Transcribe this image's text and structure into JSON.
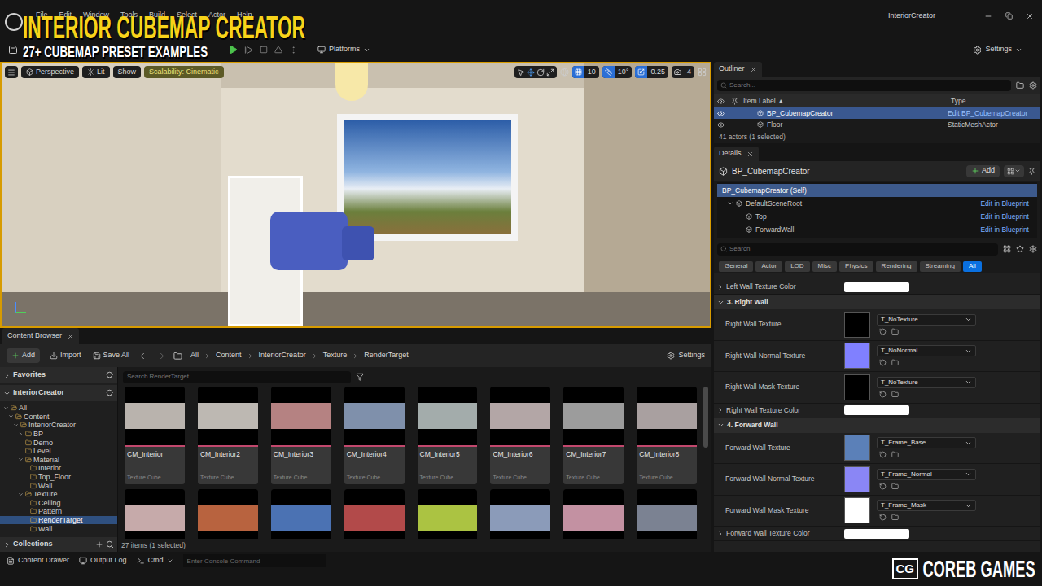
{
  "overlay": {
    "title": "INTERIOR CUBEMAP CREATOR",
    "subtitle": "27+ CUBEMAP PRESET EXAMPLES"
  },
  "menu": [
    "File",
    "Edit",
    "Window",
    "Tools",
    "Build",
    "Select",
    "Actor",
    "Help"
  ],
  "window": {
    "title": "InteriorCreator"
  },
  "toolbar": {
    "platforms": "Platforms",
    "settings": "Settings"
  },
  "viewport": {
    "buttons": [
      {
        "label": "Perspective",
        "highlighted": false
      },
      {
        "label": "Lit",
        "highlighted": false
      },
      {
        "label": "Show",
        "highlighted": false
      },
      {
        "label": "Scalability: Cinematic",
        "highlighted": true
      }
    ],
    "snaps": [
      {
        "value": "10",
        "on": true
      },
      {
        "value": "10°",
        "on": true
      },
      {
        "value": "0.25",
        "on": true
      },
      {
        "value": "4",
        "on": false
      }
    ]
  },
  "content_browser": {
    "tab": "Content Browser",
    "actions": [
      "Add",
      "Import",
      "Save All"
    ],
    "breadcrumb": [
      "All",
      "Content",
      "InteriorCreator",
      "Texture",
      "RenderTarget"
    ],
    "settings": "Settings",
    "search_placeholder": "Search RenderTarget",
    "sections": [
      {
        "label": "Favorites",
        "expanded": false
      },
      {
        "label": "InteriorCreator",
        "expanded": true
      }
    ],
    "tree": [
      {
        "label": "All",
        "depth": 0,
        "has_children": true,
        "expanded": true,
        "selected": false
      },
      {
        "label": "Content",
        "depth": 1,
        "has_children": true,
        "expanded": true,
        "selected": false
      },
      {
        "label": "InteriorCreator",
        "depth": 2,
        "has_children": true,
        "expanded": true,
        "selected": false
      },
      {
        "label": "BP",
        "depth": 3,
        "has_children": true,
        "expanded": false,
        "selected": false
      },
      {
        "label": "Demo",
        "depth": 3,
        "has_children": false,
        "expanded": false,
        "selected": false
      },
      {
        "label": "Level",
        "depth": 3,
        "has_children": false,
        "expanded": false,
        "selected": false
      },
      {
        "label": "Material",
        "depth": 3,
        "has_children": true,
        "expanded": true,
        "selected": false
      },
      {
        "label": "Interior",
        "depth": 4,
        "has_children": false,
        "expanded": false,
        "selected": false
      },
      {
        "label": "Top_Floor",
        "depth": 4,
        "has_children": false,
        "expanded": false,
        "selected": false
      },
      {
        "label": "Wall",
        "depth": 4,
        "has_children": false,
        "expanded": false,
        "selected": false
      },
      {
        "label": "Texture",
        "depth": 3,
        "has_children": true,
        "expanded": true,
        "selected": false
      },
      {
        "label": "Ceiling",
        "depth": 4,
        "has_children": false,
        "expanded": false,
        "selected": false
      },
      {
        "label": "Pattern",
        "depth": 4,
        "has_children": false,
        "expanded": false,
        "selected": false
      },
      {
        "label": "RenderTarget",
        "depth": 4,
        "has_children": false,
        "expanded": false,
        "selected": true
      },
      {
        "label": "Wall",
        "depth": 4,
        "has_children": false,
        "expanded": false,
        "selected": false
      }
    ],
    "collections": "Collections",
    "items": [
      {
        "name": "CM_Interior",
        "type": "Texture Cube",
        "color": "#b9b3ad",
        "selected": false
      },
      {
        "name": "CM_Interior2",
        "type": "Texture Cube",
        "color": "#bdb8b2",
        "selected": false
      },
      {
        "name": "CM_Interior3",
        "type": "Texture Cube",
        "color": "#b58282",
        "selected": false
      },
      {
        "name": "CM_Interior4",
        "type": "Texture Cube",
        "color": "#7f90ab",
        "selected": false
      },
      {
        "name": "CM_Interior5",
        "type": "Texture Cube",
        "color": "#a3acab",
        "selected": false
      },
      {
        "name": "CM_Interior6",
        "type": "Texture Cube",
        "color": "#b3a6a6",
        "selected": false
      },
      {
        "name": "CM_Interior7",
        "type": "Texture Cube",
        "color": "#9c9c9c",
        "selected": false
      },
      {
        "name": "CM_Interior8",
        "type": "Texture Cube",
        "color": "#a9a0a0",
        "selected": false
      }
    ],
    "items_partial": [
      {
        "color": "#c6aaaa"
      },
      {
        "color": "#b8633f"
      },
      {
        "color": "#4b72b3"
      },
      {
        "color": "#b24a4a"
      },
      {
        "color": "#abc342"
      },
      {
        "color": "#8b9bb9"
      },
      {
        "color": "#c391a2"
      },
      {
        "color": "#7b8292"
      }
    ],
    "status": "27 items (1 selected)"
  },
  "outliner": {
    "tab": "Outliner",
    "search_placeholder": "Search...",
    "columns": [
      "Item Label",
      "Type"
    ],
    "sort_indicator": "▲",
    "rows": [
      {
        "label": "BP_CubemapCreator",
        "type": "Edit BP_CubemapCreator",
        "selected": true
      },
      {
        "label": "Floor",
        "type": "StaticMeshActor",
        "selected": false
      }
    ],
    "status": "41 actors (1 selected)"
  },
  "details": {
    "tab": "Details",
    "actor": "BP_CubemapCreator",
    "add": "Add",
    "self": "BP_CubemapCreator (Self)",
    "components": [
      {
        "label": "DefaultSceneRoot",
        "depth": 0,
        "has_children": true,
        "expanded": true,
        "link": "Edit in Blueprint"
      },
      {
        "label": "Top",
        "depth": 1,
        "has_children": false,
        "expanded": false,
        "link": "Edit in Blueprint"
      },
      {
        "label": "ForwardWall",
        "depth": 1,
        "has_children": false,
        "expanded": false,
        "link": "Edit in Blueprint"
      }
    ],
    "search_placeholder": "Search",
    "filters": [
      {
        "label": "General",
        "selected": false
      },
      {
        "label": "Actor",
        "selected": false
      },
      {
        "label": "LOD",
        "selected": false
      },
      {
        "label": "Misc",
        "selected": false
      },
      {
        "label": "Physics",
        "selected": false
      },
      {
        "label": "Rendering",
        "selected": false
      },
      {
        "label": "Streaming",
        "selected": false
      },
      {
        "label": "All",
        "selected": true
      }
    ],
    "properties": [
      {
        "kind": "color",
        "label": "Left Wall Texture Color",
        "expanded": false,
        "swatch": "#ffffff"
      },
      {
        "kind": "section",
        "label": "3. Right Wall",
        "expanded": true
      },
      {
        "kind": "texture",
        "label": "Right Wall Texture",
        "value": "T_NoTexture",
        "swatch": "#000000"
      },
      {
        "kind": "texture",
        "label": "Right Wall Normal Texture",
        "value": "T_NoNormal",
        "swatch": "#8080ff"
      },
      {
        "kind": "texture",
        "label": "Right Wall Mask Texture",
        "value": "T_NoTexture",
        "swatch": "#000000"
      },
      {
        "kind": "color",
        "label": "Right Wall Texture Color",
        "expanded": false,
        "swatch": "#ffffff"
      },
      {
        "kind": "section",
        "label": "4. Forward Wall",
        "expanded": true
      },
      {
        "kind": "texture",
        "label": "Forward Wall Texture",
        "value": "T_Frame_Base",
        "swatch": "#5b80b8"
      },
      {
        "kind": "texture",
        "label": "Forward Wall Normal Texture",
        "value": "T_Frame_Normal",
        "swatch": "#8a86f5"
      },
      {
        "kind": "texture",
        "label": "Forward Wall Mask Texture",
        "value": "T_Frame_Mask",
        "swatch": "#ffffff"
      },
      {
        "kind": "color",
        "label": "Forward Wall Texture Color",
        "expanded": false,
        "swatch": "#ffffff"
      }
    ]
  },
  "status_bar": {
    "buttons": [
      "Content Drawer",
      "Output Log",
      "Cmd"
    ],
    "console_placeholder": "Enter Console Command"
  },
  "logo": {
    "badge": "CG",
    "name": "COREB GAMES"
  }
}
